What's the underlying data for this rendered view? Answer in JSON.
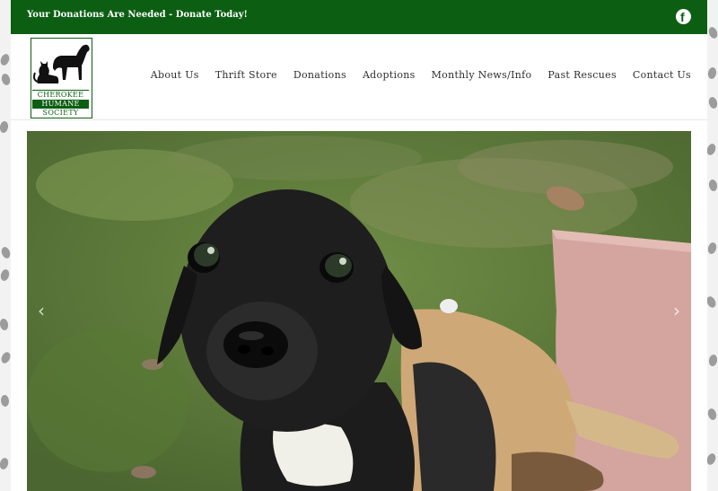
{
  "topbar": {
    "announcement": "Your Donations Are Needed - Donate Today!",
    "social_icon": "facebook-icon",
    "color": "#0c5e13"
  },
  "logo": {
    "line1": "CHEROKEE",
    "line2": "HUMANE",
    "line3": "SOCIETY"
  },
  "nav": {
    "items": [
      {
        "label": "About Us"
      },
      {
        "label": "Thrift Store"
      },
      {
        "label": "Donations"
      },
      {
        "label": "Adoptions"
      },
      {
        "label": "Monthly News/Info"
      },
      {
        "label": "Past Rescues"
      },
      {
        "label": "Contact Us"
      }
    ]
  },
  "hero": {
    "prev_icon": "chevron-left-icon",
    "next_icon": "chevron-right-icon",
    "prev_glyph": "‹",
    "next_glyph": "›"
  }
}
